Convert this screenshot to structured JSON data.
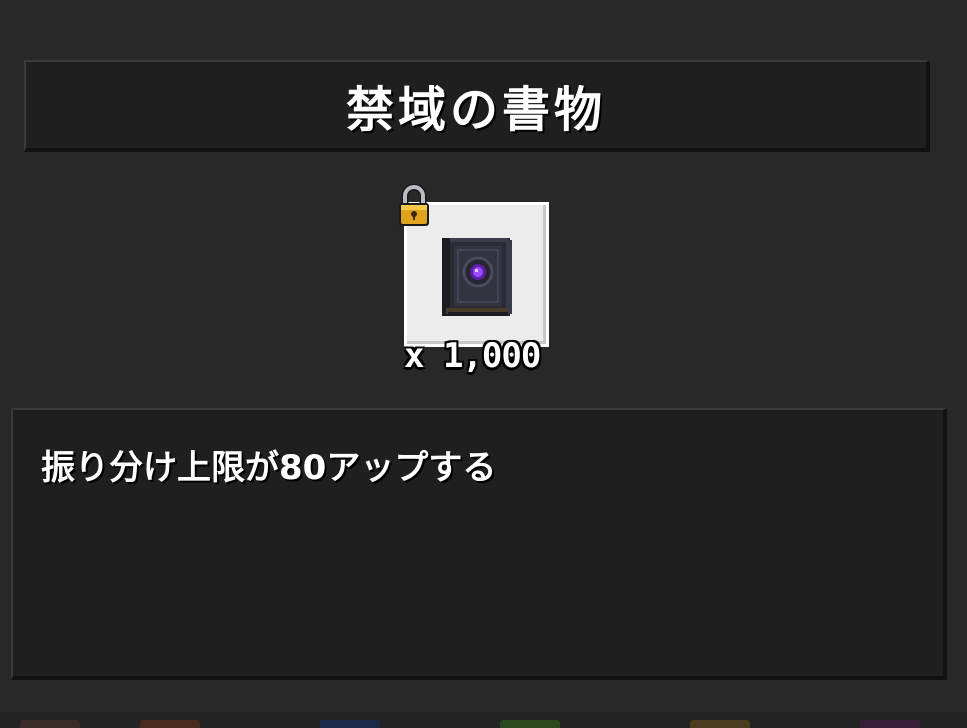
{
  "item": {
    "name": "禁域の書物",
    "quantity": "x 1,000",
    "locked": true,
    "icon": "dark-tome-icon",
    "description": "振り分け上限が80アップする"
  },
  "colors": {
    "background": "#282828",
    "panel": "#1f1f1f",
    "slot": "#ececec",
    "text": "#ffffff",
    "gem": "#8a2be2"
  }
}
